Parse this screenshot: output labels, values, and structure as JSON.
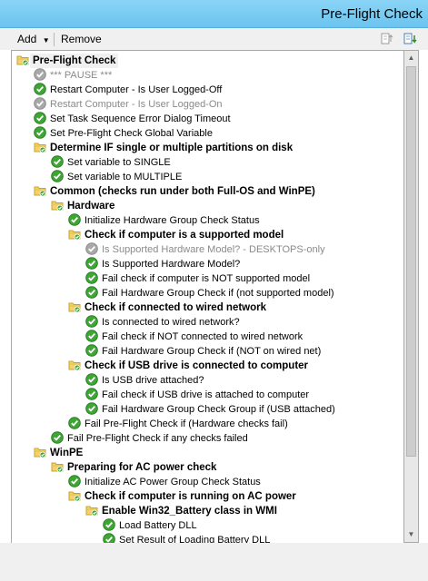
{
  "window": {
    "title": "Pre-Flight Check"
  },
  "toolbar": {
    "add_label": "Add",
    "remove_label": "Remove"
  },
  "tree": [
    {
      "label": "Pre-Flight Check",
      "type": "group",
      "level": 0
    },
    {
      "label": "*** PAUSE ***",
      "type": "disabled",
      "level": 1
    },
    {
      "label": "Restart Computer - Is User Logged-Off",
      "type": "step",
      "level": 1
    },
    {
      "label": "Restart Computer - Is User Logged-On",
      "type": "disabled",
      "level": 1
    },
    {
      "label": "Set Task Sequence Error Dialog Timeout",
      "type": "step",
      "level": 1
    },
    {
      "label": "Set Pre-Flight Check Global Variable",
      "type": "step",
      "level": 1
    },
    {
      "label": "Determine IF single or multiple partitions on disk",
      "type": "group",
      "level": 1
    },
    {
      "label": "Set variable to SINGLE",
      "type": "step",
      "level": 2
    },
    {
      "label": "Set variable to MULTIPLE",
      "type": "step",
      "level": 2
    },
    {
      "label": "Common (checks run under both Full-OS and WinPE)",
      "type": "group",
      "level": 1
    },
    {
      "label": "Hardware",
      "type": "group",
      "level": 2
    },
    {
      "label": "Initialize Hardware Group Check Status",
      "type": "step",
      "level": 3
    },
    {
      "label": "Check if computer is a supported model",
      "type": "group",
      "level": 3
    },
    {
      "label": "Is Supported Hardware Model? - DESKTOPS-only",
      "type": "disabled",
      "level": 4
    },
    {
      "label": "Is Supported Hardware Model?",
      "type": "step",
      "level": 4
    },
    {
      "label": "Fail check if computer is NOT supported model",
      "type": "step",
      "level": 4
    },
    {
      "label": "Fail Hardware Group Check if (not supported model)",
      "type": "step",
      "level": 4
    },
    {
      "label": "Check if connected to wired network",
      "type": "group",
      "level": 3
    },
    {
      "label": "Is connected to wired network?",
      "type": "step",
      "level": 4
    },
    {
      "label": "Fail check if NOT connected to wired network",
      "type": "step",
      "level": 4
    },
    {
      "label": "Fail Hardware Group Check if (NOT on wired net)",
      "type": "step",
      "level": 4
    },
    {
      "label": "Check if USB drive is connected to computer",
      "type": "group",
      "level": 3
    },
    {
      "label": "Is USB drive attached?",
      "type": "step",
      "level": 4
    },
    {
      "label": "Fail check if USB drive is attached to computer",
      "type": "step",
      "level": 4
    },
    {
      "label": "Fail Hardware Group Check Group if (USB attached)",
      "type": "step",
      "level": 4
    },
    {
      "label": "Fail Pre-Flight Check if (Hardware checks fail)",
      "type": "step",
      "level": 3
    },
    {
      "label": "Fail Pre-Flight Check if any checks failed",
      "type": "step",
      "level": 2
    },
    {
      "label": "WinPE",
      "type": "group",
      "level": 1
    },
    {
      "label": "Preparing for AC power check",
      "type": "group",
      "level": 2
    },
    {
      "label": "Initialize AC Power Group Check Status",
      "type": "step",
      "level": 3
    },
    {
      "label": "Check if computer is running on AC power",
      "type": "group",
      "level": 3
    },
    {
      "label": "Enable Win32_Battery class in WMI",
      "type": "group",
      "level": 4
    },
    {
      "label": "Load Battery DLL",
      "type": "step",
      "level": 5
    },
    {
      "label": "Set Result of Loading Battery DLL",
      "type": "step",
      "level": 5
    }
  ],
  "colors": {
    "titlebar": "#6cc4ef",
    "check_green": "#3fa535",
    "folder_yellow": "#f2d36b",
    "disabled_gray": "#a8a8a8"
  }
}
